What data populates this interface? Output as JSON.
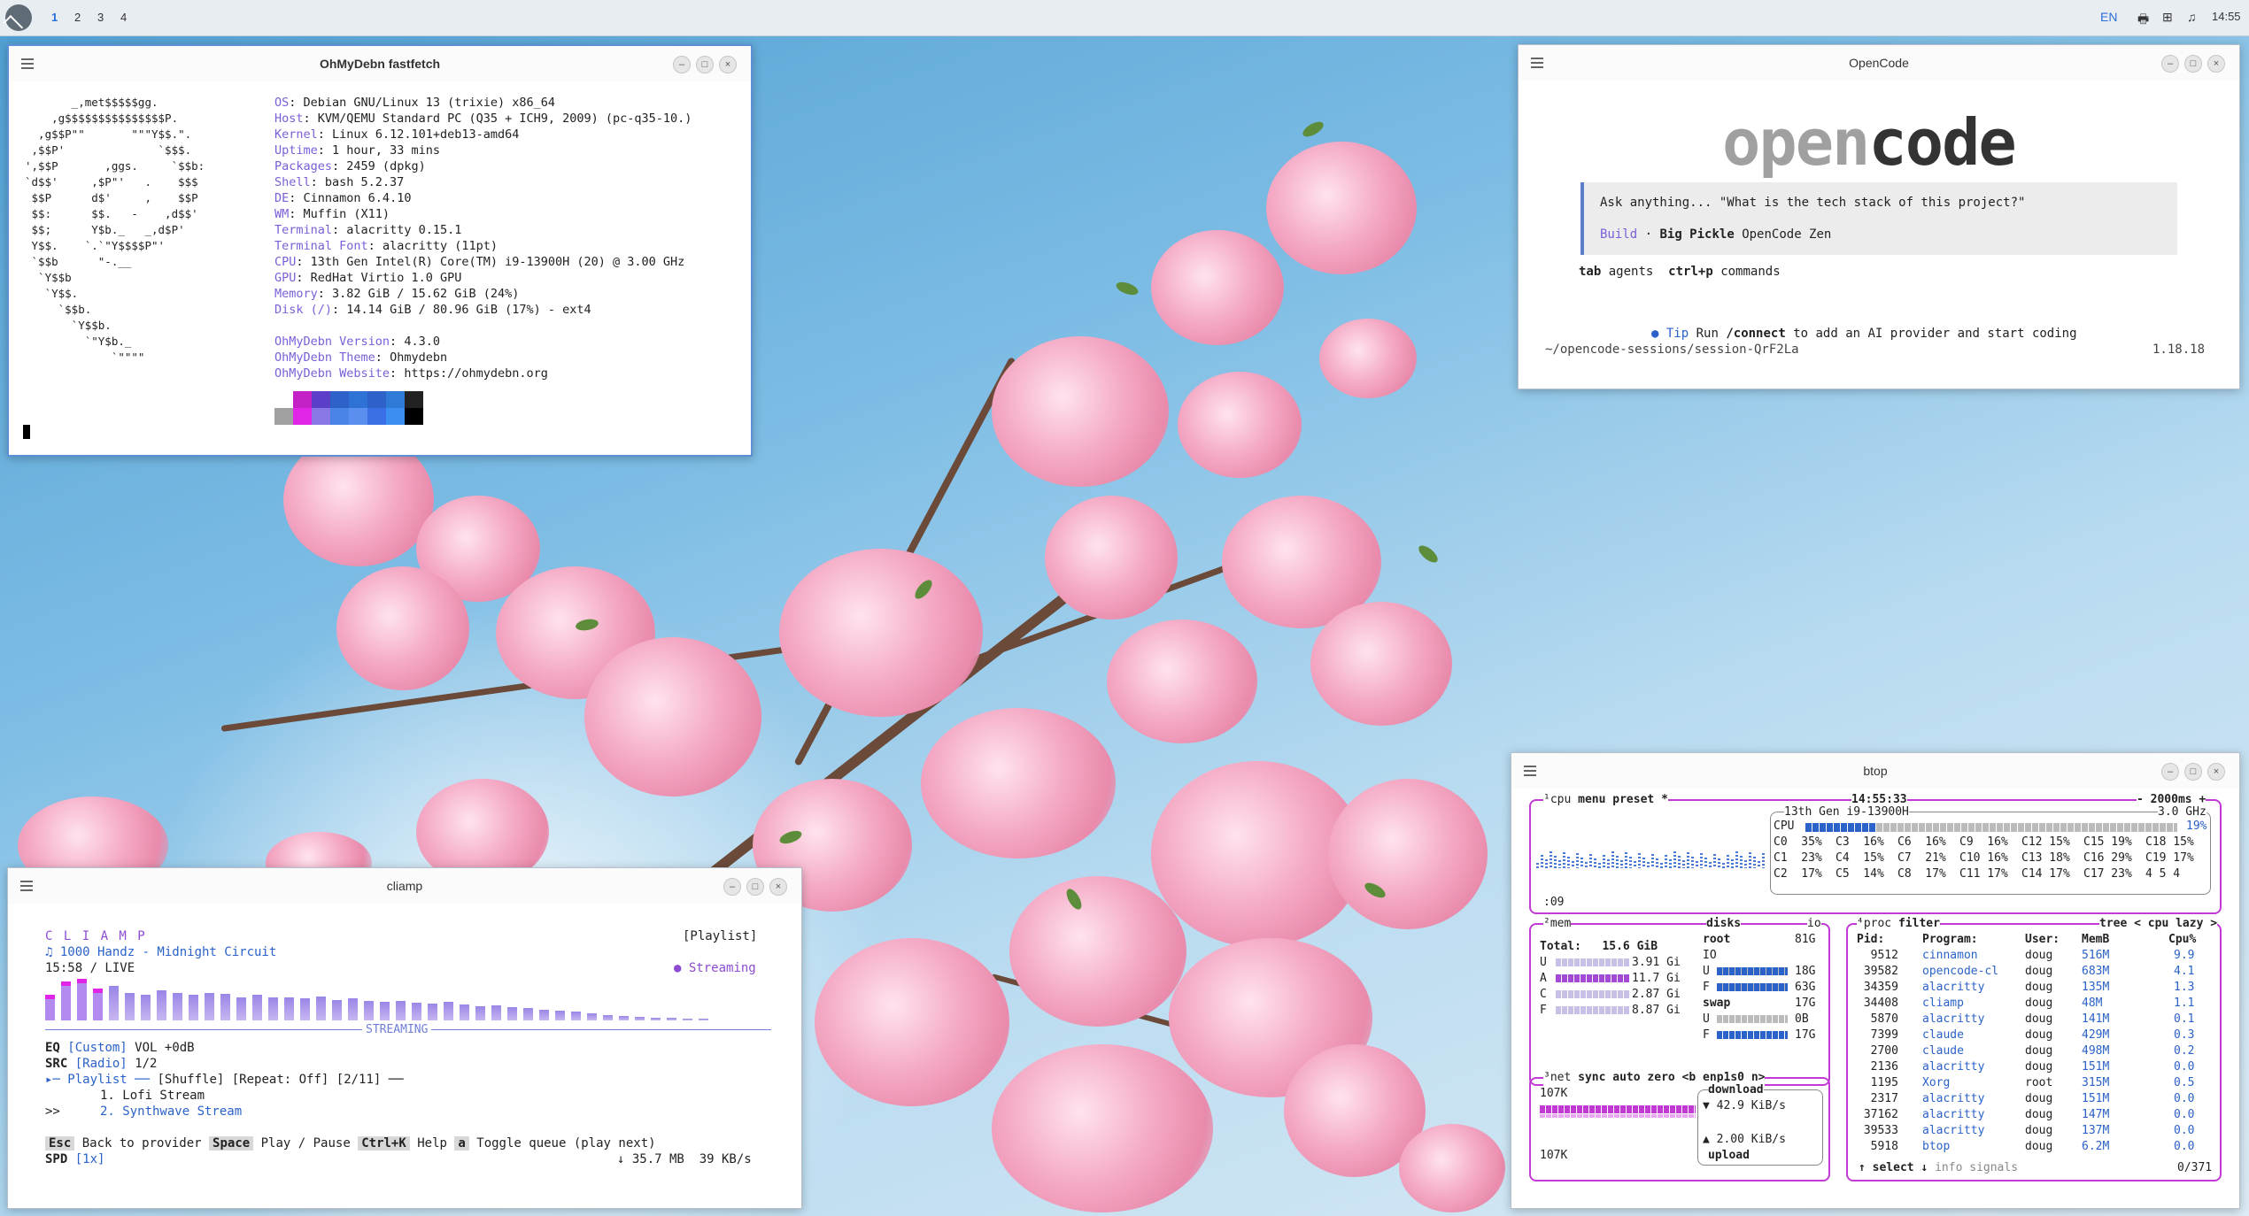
{
  "panel": {
    "workspaces": [
      "1",
      "2",
      "3",
      "4"
    ],
    "lang": "EN",
    "clock": "14:55",
    "printer_icon": "printer-icon",
    "network_icon": "network-icon",
    "sound_icon": "music-note-icon"
  },
  "fastfetch": {
    "title": "OhMyDebn fastfetch",
    "logo": "       _,met$$$$$gg.\n    ,g$$$$$$$$$$$$$$$P.\n  ,g$$P\"\"       \"\"\"Y$$.\".\n ,$$P'              `$$$.\n',$$P       ,ggs.     `$$b:\n`d$$'     ,$P\"'   .    $$$\n $$P      d$'     ,    $$P\n $$:      $$.   -    ,d$$'\n $$;      Y$b._   _,d$P'\n Y$$.    `.`\"Y$$$$P\"'\n `$$b      \"-.__\n  `Y$$b\n   `Y$$.\n     `$$b.\n       `Y$$b.\n         `\"Y$b._\n             `\"\"\"\"",
    "info": [
      {
        "k": "OS",
        "v": "Debian GNU/Linux 13 (trixie) x86_64"
      },
      {
        "k": "Host",
        "v": "KVM/QEMU Standard PC (Q35 + ICH9, 2009) (pc-q35-10.)"
      },
      {
        "k": "Kernel",
        "v": "Linux 6.12.101+deb13-amd64"
      },
      {
        "k": "Uptime",
        "v": "1 hour, 33 mins"
      },
      {
        "k": "Packages",
        "v": "2459 (dpkg)"
      },
      {
        "k": "Shell",
        "v": "bash 5.2.37"
      },
      {
        "k": "DE",
        "v": "Cinnamon 6.4.10"
      },
      {
        "k": "WM",
        "v": "Muffin (X11)"
      },
      {
        "k": "Terminal",
        "v": "alacritty 0.15.1"
      },
      {
        "k": "Terminal Font",
        "v": "alacritty (11pt)"
      },
      {
        "k": "CPU",
        "v": "13th Gen Intel(R) Core(TM) i9-13900H (20) @ 3.00 GHz"
      },
      {
        "k": "GPU",
        "v": "RedHat Virtio 1.0 GPU"
      },
      {
        "k": "Memory",
        "v": "3.82 GiB / 15.62 GiB (24%)"
      },
      {
        "k": "Disk (/)",
        "v": "14.14 GiB / 80.96 GiB (17%) - ext4"
      }
    ],
    "extra": [
      {
        "k": "OhMyDebn Version",
        "v": "4.3.0"
      },
      {
        "k": "OhMyDebn Theme",
        "v": "Ohmydebn"
      },
      {
        "k": "OhMyDebn Website",
        "v": "https://ohmydebn.org"
      }
    ],
    "palette_top": [
      "#ffffff",
      "#c320c5",
      "#5b3fc9",
      "#2f62c9",
      "#2f72d6",
      "#2f62c9",
      "#2f7ad6",
      "#222222"
    ],
    "palette_bottom": [
      "#a0a0a0",
      "#e025e6",
      "#8a78e6",
      "#4a84e6",
      "#5a8ff0",
      "#3b6fe6",
      "#3b8ff0",
      "#000000"
    ]
  },
  "opencode": {
    "title": "OpenCode",
    "logo_a": "open",
    "logo_b": "code",
    "placeholder": "Ask anything... \"What is the tech stack of this project?\"",
    "mode": "Build",
    "dot": "·",
    "model": "Big Pickle",
    "provider": "OpenCode Zen",
    "hint_key1": "tab",
    "hint_txt1": "agents",
    "hint_key2": "ctrl+p",
    "hint_txt2": "commands",
    "tip_bullet": "●",
    "tip_label": "Tip",
    "tip_text1": "Run",
    "tip_cmd": "/connect",
    "tip_text2": "to add an AI provider and start coding",
    "path": "~/opencode-sessions/session-QrF2La",
    "version": "1.18.18"
  },
  "btop": {
    "title": "btop",
    "cpu_header": "¹cpu",
    "menu": "menu",
    "preset": "preset *",
    "time": "14:55:33",
    "interval": "- 2000ms +",
    "cpu_model": "13th Gen i9-13900H",
    "freq": "3.0 GHz",
    "cpu_total_label": "CPU",
    "cpu_total": "19%",
    "cores_col1": [
      "C0  35%",
      "C1  23%",
      "C2  17%"
    ],
    "cores_col2": [
      "C3  16%",
      "C4  15%",
      "C5  14%"
    ],
    "cores_col3": [
      "C6  16%",
      "C7  21%",
      "C8  17%"
    ],
    "cores_col4": [
      "C9  16%",
      "C10 16%",
      "C11 17%"
    ],
    "cores_col5": [
      "C12 15%",
      "C13 18%",
      "C14 17%"
    ],
    "cores_col6": [
      "C15 19%",
      "C16 29%",
      "C17 23%"
    ],
    "cores_col7": [
      "C18 15%",
      "C19 17%",
      "4 5 4"
    ],
    "uptime": ":09",
    "mem_header": "²mem",
    "mem_total": "Total:   15.6 GiB",
    "mem_rows": [
      {
        "k": "U",
        "v": "3.91 Gi"
      },
      {
        "k": "A",
        "v": "11.7 Gi"
      },
      {
        "k": "C",
        "v": "2.87 Gi"
      },
      {
        "k": "F",
        "v": "8.87 Gi"
      }
    ],
    "disks_header": "disks",
    "io_label": "io",
    "disk_root": "root",
    "disk_root_size": "81G",
    "disk_io": "IO",
    "disk_u": "18G",
    "disk_f": "63G",
    "swap": "swap",
    "swap_size": "17G",
    "swap_u": "0B",
    "swap_f": "17G",
    "net_header": "³net",
    "net_sync": "sync",
    "net_auto": "auto",
    "net_zero": "zero",
    "net_iface": "<b enp1s0 n>",
    "net_top": "107K",
    "net_bottom": "107K",
    "download_label": "download",
    "download_val": "▼ 42.9 KiB/s",
    "upload_val": "▲ 2.00 KiB/s",
    "upload_label": "upload",
    "proc_header": "⁴proc",
    "proc_filter": "filter",
    "proc_tree": "tree",
    "proc_sort": "< cpu lazy >",
    "proc_cols": [
      "Pid:",
      "Program:",
      "User:",
      "MemB",
      "Cpu%"
    ],
    "procs": [
      {
        "pid": "9512",
        "prog": "cinnamon",
        "user": "doug",
        "mem": "516M",
        "cpu": "9.9"
      },
      {
        "pid": "39582",
        "prog": "opencode-cl",
        "user": "doug",
        "mem": "683M",
        "cpu": "4.1"
      },
      {
        "pid": "34359",
        "prog": "alacritty",
        "user": "doug",
        "mem": "135M",
        "cpu": "1.3"
      },
      {
        "pid": "34408",
        "prog": "cliamp",
        "user": "doug",
        "mem": "48M",
        "cpu": "1.1"
      },
      {
        "pid": "5870",
        "prog": "alacritty",
        "user": "doug",
        "mem": "141M",
        "cpu": "0.1"
      },
      {
        "pid": "7399",
        "prog": "claude",
        "user": "doug",
        "mem": "429M",
        "cpu": "0.3"
      },
      {
        "pid": "2700",
        "prog": "claude",
        "user": "doug",
        "mem": "498M",
        "cpu": "0.2"
      },
      {
        "pid": "2136",
        "prog": "alacritty",
        "user": "doug",
        "mem": "151M",
        "cpu": "0.0"
      },
      {
        "pid": "1195",
        "prog": "Xorg",
        "user": "root",
        "mem": "315M",
        "cpu": "0.5"
      },
      {
        "pid": "2317",
        "prog": "alacritty",
        "user": "doug",
        "mem": "151M",
        "cpu": "0.0"
      },
      {
        "pid": "37162",
        "prog": "alacritty",
        "user": "doug",
        "mem": "147M",
        "cpu": "0.0"
      },
      {
        "pid": "39533",
        "prog": "alacritty",
        "user": "doug",
        "mem": "137M",
        "cpu": "0.0"
      },
      {
        "pid": "5918",
        "prog": "btop",
        "user": "doug",
        "mem": "6.2M",
        "cpu": "0.0"
      }
    ],
    "footer_select": "↑ select ↓",
    "footer_info": "info",
    "footer_signals": "signals",
    "footer_count": "0/371"
  },
  "cliamp": {
    "title": "cliamp",
    "logo": "C L I A M P",
    "now_playing": "♫ 1000 Handz - Midnight Circuit",
    "position": "15:58 / LIVE",
    "playlist_tag": "[Playlist]",
    "streaming_dot": "●",
    "streaming": "Streaming",
    "streaming_label": "STREAMING",
    "eq_label": "EQ",
    "eq_val": "[Custom]",
    "vol": "VOL +0dB",
    "src_label": "SRC",
    "src_val": "[Radio]",
    "src_pos": "1/2",
    "pl_label": "▸─ Playlist ──",
    "shuffle": "[Shuffle]",
    "repeat": "[Repeat: Off]",
    "count": "[2/11]",
    "pl_end": "──",
    "item1": "1. Lofi Stream",
    "item2_marker": ">>",
    "item2": "2. Synthwave Stream",
    "keys": [
      {
        "key": "Esc",
        "desc": "Back to provider"
      },
      {
        "key": "Space",
        "desc": "Play / Pause"
      },
      {
        "key": "Ctrl+K",
        "desc": "Help"
      },
      {
        "key": "a",
        "desc": "Toggle queue (play next)"
      }
    ],
    "spd_label": "SPD",
    "spd_val": "[1x]",
    "net_stats": "↓ 35.7 MB  39 KB/s",
    "spectrum": [
      0.55,
      0.85,
      0.9,
      0.7,
      0.75,
      0.6,
      0.55,
      0.65,
      0.6,
      0.55,
      0.6,
      0.58,
      0.5,
      0.55,
      0.5,
      0.5,
      0.48,
      0.52,
      0.45,
      0.48,
      0.42,
      0.4,
      0.42,
      0.38,
      0.36,
      0.4,
      0.34,
      0.3,
      0.32,
      0.28,
      0.26,
      0.24,
      0.22,
      0.2,
      0.15,
      0.12,
      0.1,
      0.08,
      0.06,
      0.05,
      0.04,
      0.03
    ]
  }
}
